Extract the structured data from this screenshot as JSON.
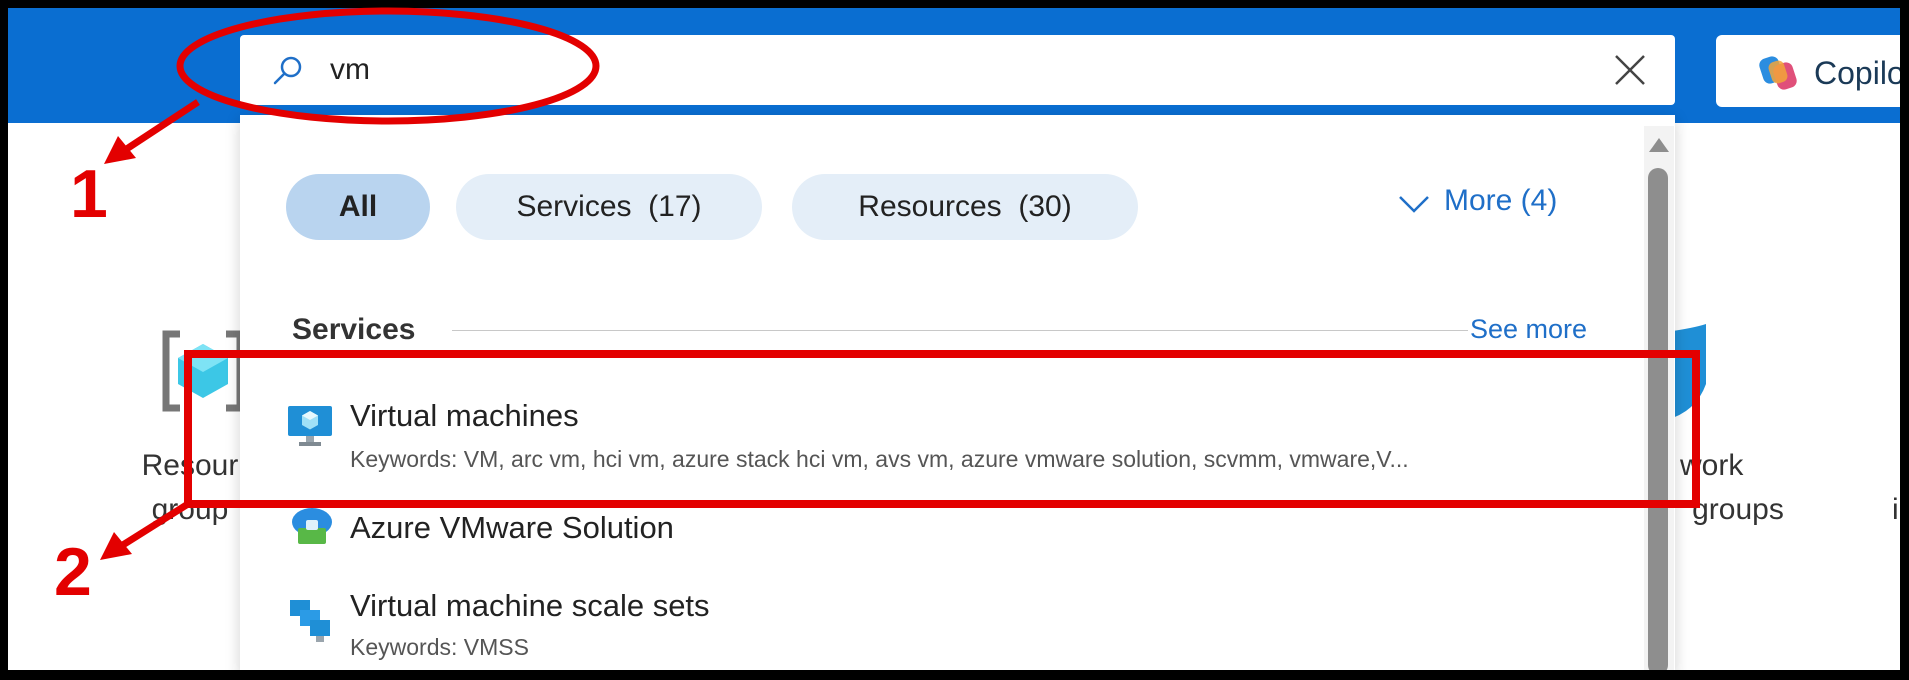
{
  "search": {
    "value": "vm",
    "clear_icon": "close-icon"
  },
  "copilot": {
    "label": "Copilo",
    "icon": "copilot-icon"
  },
  "background": {
    "tile_left_line1": "Resour",
    "tile_left_line2": "group",
    "tile_right_line1": "work",
    "tile_right_line2": "groups",
    "tile_far_right": "i"
  },
  "filters": {
    "all": "All",
    "services": "Services  (17)",
    "resources": "Resources  (30)",
    "more": "More (4)"
  },
  "services_section": {
    "title": "Services",
    "see_more": "See more",
    "items": [
      {
        "title": "Virtual machines",
        "keywords": "Keywords: VM, arc vm, hci vm, azure stack hci vm, avs vm, azure vmware solution, scvmm, vmware,V...",
        "icon": "virtual-machine-icon"
      },
      {
        "title": "Azure VMware Solution",
        "icon": "vmware-solution-icon"
      },
      {
        "title": "Virtual machine scale sets",
        "keywords": "Keywords: VMSS",
        "icon": "scale-sets-icon"
      }
    ]
  },
  "annotations": {
    "step1": "1",
    "step2": "2",
    "color": "#e30000"
  },
  "colors": {
    "topbar": "#0a6ed1",
    "chip": "#e4eef8",
    "chip_active": "#b9d4ef",
    "link": "#1f6fc8"
  }
}
